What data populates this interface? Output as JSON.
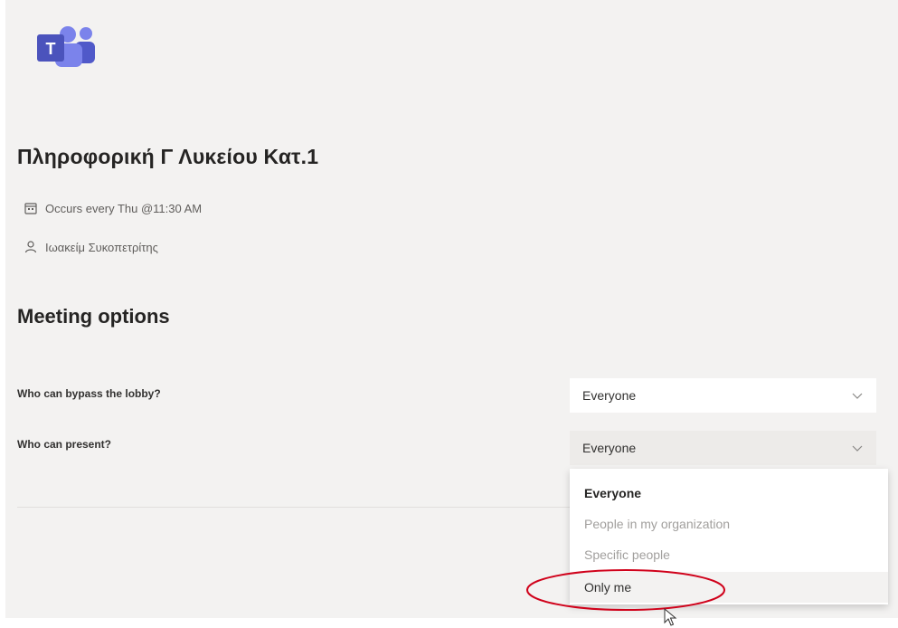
{
  "app": {
    "logo_icon": "microsoft-teams-logo",
    "brand_color": "#5b5fc7",
    "logo_letter": "T"
  },
  "meeting": {
    "title": "Πληροφορική Γ Λυκείου Κατ.1",
    "recurrence": "Occurs every Thu @11:30 AM",
    "recurrence_icon": "calendar-icon",
    "organizer": "Ιωακείμ Συκοπετρίτης",
    "organizer_icon": "person-icon"
  },
  "options": {
    "section_title": "Meeting options",
    "lobby": {
      "label": "Who can bypass the lobby?",
      "value": "Everyone"
    },
    "present": {
      "label": "Who can present?",
      "value": "Everyone",
      "open": true,
      "choices": [
        "Everyone",
        "People in my organization",
        "Specific people",
        "Only me"
      ],
      "selected_index": 0,
      "hovered_index": 3
    }
  },
  "annotation_color": "#d0021b"
}
